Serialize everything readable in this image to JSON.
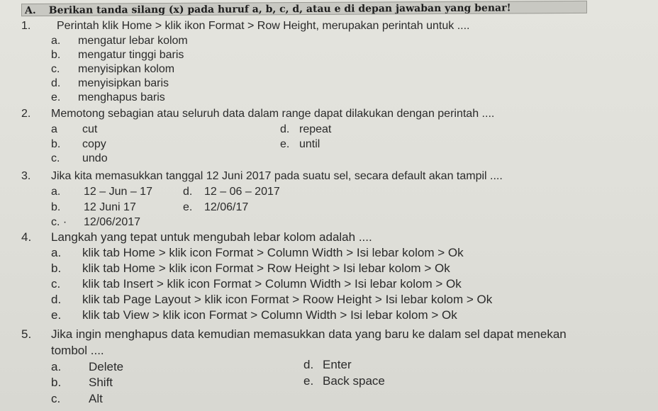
{
  "header": {
    "letter": "A.",
    "instruction": "Berikan tanda silang (x) pada huruf a, b, c, d, atau e di depan jawaban yang benar!"
  },
  "questions": [
    {
      "number": "1.",
      "text": "Perintah klik Home > klik ikon Format > Row Height, merupakan perintah untuk ....",
      "options": [
        {
          "letter": "a.",
          "text": "mengatur lebar  kolom"
        },
        {
          "letter": "b.",
          "text": "mengatur tinggi baris"
        },
        {
          "letter": "c.",
          "text": "menyisipkan kolom"
        },
        {
          "letter": "d.",
          "text": "menyisipkan baris"
        },
        {
          "letter": "e.",
          "text": "menghapus baris"
        }
      ]
    },
    {
      "number": "2.",
      "text": "Memotong sebagian atau seluruh data dalam range dapat dilakukan dengan perintah ....",
      "options": [
        {
          "letter": "a",
          "text": "cut"
        },
        {
          "letter": "b.",
          "text": "copy"
        },
        {
          "letter": "c.",
          "text": "undo"
        },
        {
          "letter": "d.",
          "text": "repeat"
        },
        {
          "letter": "e.",
          "text": "until"
        }
      ]
    },
    {
      "number": "3.",
      "text": "Jika kita memasukkan tanggal 12 Juni  2017 pada suatu  sel, secara default akan tampil ....",
      "options": [
        {
          "letter": "a.",
          "text": "12 – Jun – 17"
        },
        {
          "letter": "b.",
          "text": "12 Juni 17"
        },
        {
          "letter": "c. ·",
          "text": "12/06/2017"
        },
        {
          "letter": "d.",
          "text": "12 – 06 – 2017"
        },
        {
          "letter": "e.",
          "text": "12/06/17"
        }
      ]
    },
    {
      "number": "4.",
      "text": "Langkah yang tepat untuk mengubah lebar kolom adalah ....",
      "options": [
        {
          "letter": "a.",
          "text": "klik tab Home  > klik icon Format > Column Width > Isi lebar kolom > Ok"
        },
        {
          "letter": "b.",
          "text": "klik tab Home  > klik icon Format > Row Height > Isi lebar kolom > Ok"
        },
        {
          "letter": "c.",
          "text": "klik tab Insert  > klik icon Format > Column Width > Isi lebar kolom > Ok"
        },
        {
          "letter": "d.",
          "text": "klik tab Page Layout  > klik icon Format > Roow Height > Isi lebar kolom > Ok"
        },
        {
          "letter": "e.",
          "text": "klik tab View > klik icon Format > Column Width > Isi lebar kolom > Ok"
        }
      ]
    },
    {
      "number": "5.",
      "text": "Jika ingin menghapus data kemudian memasukkan data yang baru ke dalam sel dapat menekan",
      "text_cont": "tombol ....",
      "options": [
        {
          "letter": "a.",
          "text": "Delete"
        },
        {
          "letter": "b.",
          "text": "Shift"
        },
        {
          "letter": "c.",
          "text": "Alt"
        },
        {
          "letter": "d.",
          "text": "Enter"
        },
        {
          "letter": "e.",
          "text": "Back space"
        }
      ]
    }
  ]
}
